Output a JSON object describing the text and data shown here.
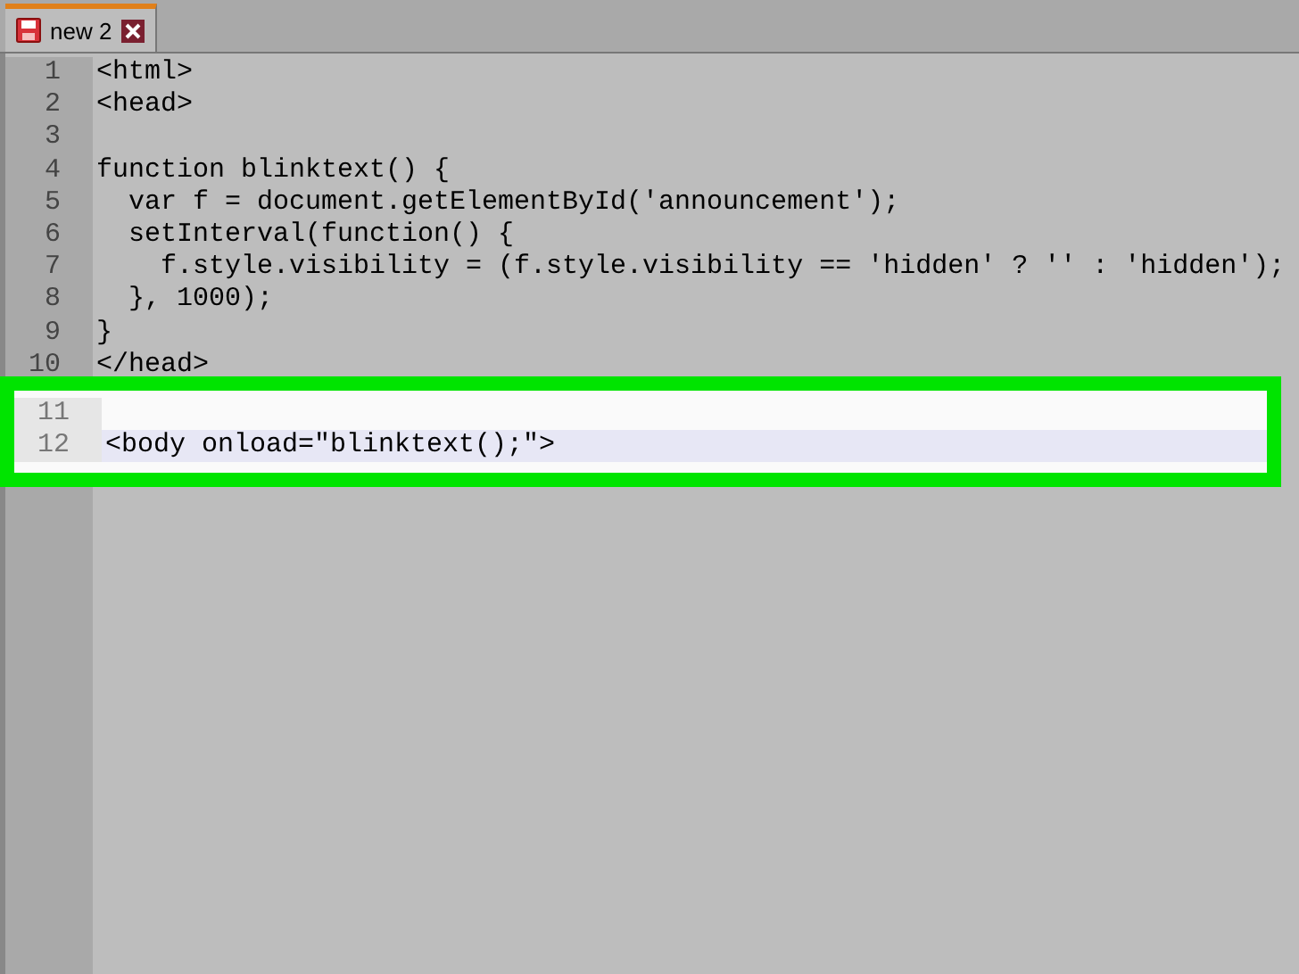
{
  "tab": {
    "label": "new 2",
    "selected": true
  },
  "lines": [
    {
      "number": "1",
      "text": "<html>",
      "current": false
    },
    {
      "number": "2",
      "text": "<head>",
      "current": false
    },
    {
      "number": "3",
      "current": false
    },
    {
      "number": "4",
      "text": "function blinktext() {",
      "current": false
    },
    {
      "number": "5",
      "text": "  var f = document.getElementById('announcement');",
      "current": false
    },
    {
      "number": "6",
      "text": "  setInterval(function() {",
      "current": false
    },
    {
      "number": "7",
      "text": "    f.style.visibility = (f.style.visibility == 'hidden' ? '' : 'hidden');",
      "current": false
    },
    {
      "number": "8",
      "text": "  }, 1000);",
      "current": false
    },
    {
      "number": "9",
      "text": "}",
      "current": false
    },
    {
      "number": "10",
      "text": "</head>",
      "current": false
    }
  ],
  "highlighted_lines": [
    {
      "number": "11",
      "current": false
    },
    {
      "number": "12",
      "text": "<body onload=\"blinktext();\">",
      "current": true
    }
  ]
}
